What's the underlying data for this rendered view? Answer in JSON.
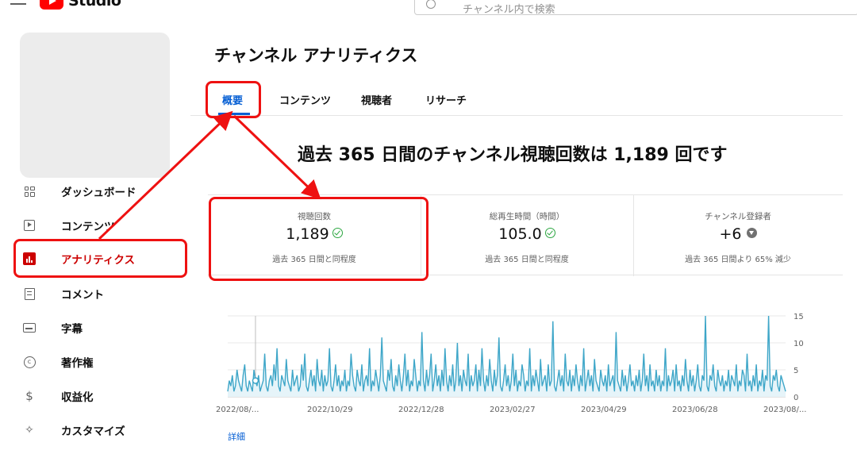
{
  "header": {
    "logo_text": "Studio",
    "search_placeholder": "チャンネル内で検索"
  },
  "sidebar": {
    "items": [
      {
        "label": "ダッシュボード",
        "icon": "dashboard-icon"
      },
      {
        "label": "コンテンツ",
        "icon": "content-icon"
      },
      {
        "label": "アナリティクス",
        "icon": "analytics-icon",
        "active": true
      },
      {
        "label": "コメント",
        "icon": "comment-icon"
      },
      {
        "label": "字幕",
        "icon": "subtitles-icon"
      },
      {
        "label": "著作権",
        "icon": "copyright-icon"
      },
      {
        "label": "収益化",
        "icon": "monetization-icon"
      },
      {
        "label": "カスタマイズ",
        "icon": "customization-icon"
      }
    ]
  },
  "main": {
    "title": "チャンネル アナリティクス",
    "tabs": [
      {
        "label": "概要",
        "active": true
      },
      {
        "label": "コンテンツ"
      },
      {
        "label": "視聴者"
      },
      {
        "label": "リサーチ"
      }
    ],
    "headline": "過去 365 日間のチャンネル視聴回数は 1,189 回です",
    "metrics": [
      {
        "label": "視聴回数",
        "value": "1,189",
        "status": "check",
        "note": "過去 365 日間と同程度"
      },
      {
        "label": "総再生時間（時間）",
        "value": "105.0",
        "status": "check",
        "note": "過去 365 日間と同程度"
      },
      {
        "label": "チャンネル登録者",
        "value": "+6",
        "status": "down",
        "note": "過去 365 日間より 65% 減少"
      }
    ],
    "more_link": "詳細"
  },
  "colors": {
    "accent_blue": "#065fd4",
    "brand_red": "#ff0000",
    "highlight_red": "#ee1111",
    "chart_line": "#3ea6c8"
  },
  "chart_data": {
    "type": "line",
    "x_tick_labels": [
      "2022/08/...",
      "2022/10/29",
      "2022/12/28",
      "2023/02/27",
      "2023/04/29",
      "2023/06/28",
      "2023/08/..."
    ],
    "y_tick_labels": [
      "0",
      "5",
      "10",
      "15"
    ],
    "ylim": [
      0,
      15
    ],
    "series": [
      {
        "values": [
          1,
          3,
          2,
          4,
          1,
          2,
          5,
          3,
          2,
          1,
          4,
          6,
          2,
          1,
          3,
          2,
          1,
          5,
          3,
          2,
          4,
          1,
          2,
          3,
          8,
          2,
          1,
          3,
          4,
          2,
          6,
          3,
          9,
          2,
          1,
          4,
          3,
          2,
          7,
          3,
          2,
          1,
          5,
          2,
          3,
          4,
          1,
          2,
          6,
          3,
          8,
          2,
          1,
          3,
          5,
          2,
          4,
          1,
          7,
          3,
          2,
          5,
          1,
          4,
          2,
          3,
          9,
          2,
          1,
          3,
          6,
          2,
          4,
          1,
          3,
          2,
          5,
          1,
          3,
          2,
          8,
          4,
          2,
          1,
          5,
          3,
          2,
          6,
          1,
          3,
          4,
          2,
          9,
          1,
          3,
          2,
          5,
          3,
          1,
          4,
          11,
          3,
          2,
          1,
          5,
          3,
          7,
          2,
          1,
          4,
          2,
          6,
          3,
          1,
          4,
          8,
          2,
          5,
          1,
          3,
          2,
          7,
          4,
          1,
          3,
          2,
          12,
          3,
          1,
          5,
          2,
          4,
          8,
          1,
          3,
          6,
          2,
          4,
          1,
          5,
          2,
          9,
          3,
          1,
          4,
          2,
          6,
          1,
          3,
          10,
          2,
          4,
          1,
          5,
          3,
          2,
          8,
          1,
          4,
          2,
          3,
          6,
          1,
          5,
          2,
          9,
          3,
          1,
          4,
          2,
          7,
          3,
          1,
          5,
          2,
          4,
          11,
          2,
          1,
          3,
          6,
          2,
          4,
          1,
          3,
          8,
          2,
          5,
          1,
          3,
          2,
          6,
          4,
          1,
          3,
          2,
          9,
          1,
          4,
          2,
          5,
          3,
          1,
          7,
          2,
          3,
          4,
          1,
          6,
          2,
          3,
          14,
          2,
          1,
          3,
          5,
          2,
          4,
          1,
          8,
          3,
          2,
          5,
          1,
          4,
          2,
          6,
          3,
          1,
          4,
          2,
          9,
          1,
          3,
          5,
          2,
          4,
          1,
          7,
          3,
          2,
          1,
          5,
          3,
          2,
          4,
          1,
          6,
          2,
          3,
          4,
          1,
          12,
          3,
          2,
          1,
          5,
          2,
          4,
          1,
          3,
          6,
          2,
          3,
          1,
          4,
          2,
          5,
          1,
          3,
          8,
          2,
          4,
          1,
          6,
          2,
          3,
          1,
          5,
          2,
          4,
          1,
          3,
          2,
          9,
          1,
          4,
          2,
          3,
          5,
          1,
          6,
          2,
          3,
          1,
          4,
          2,
          7,
          3,
          1,
          5,
          2,
          4,
          1,
          3,
          6,
          2,
          1,
          4,
          3,
          15,
          2,
          1,
          4,
          3,
          6,
          2,
          1,
          5,
          3,
          2,
          4,
          1,
          3,
          2,
          5,
          1,
          4,
          3,
          2,
          6,
          1,
          3,
          2,
          5,
          4,
          1,
          8,
          2,
          3,
          1,
          4,
          2,
          6,
          1,
          3,
          2,
          5,
          1,
          4,
          3,
          15,
          2,
          1,
          4,
          3,
          5,
          2,
          1,
          4,
          3,
          2,
          1
        ]
      }
    ],
    "highlighted_point": {
      "index": 18,
      "value": 3
    }
  }
}
